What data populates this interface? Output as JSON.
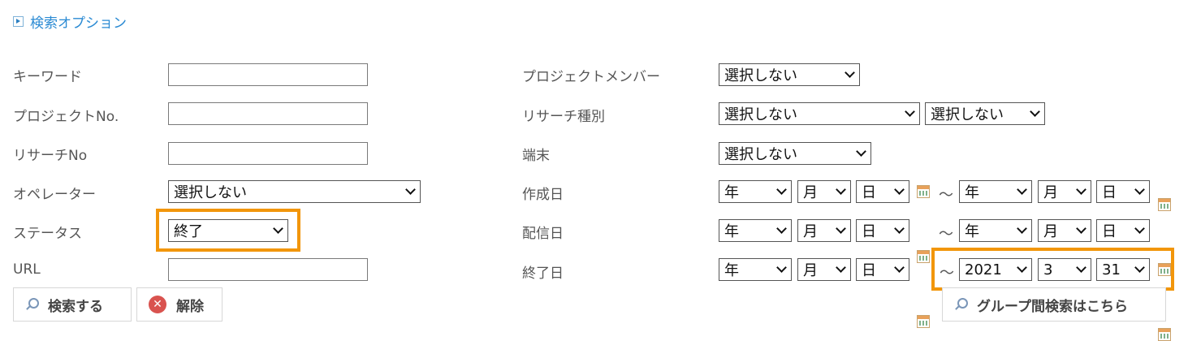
{
  "search_options": {
    "label": "検索オプション"
  },
  "left": {
    "keyword_label": "キーワード",
    "keyword_value": "",
    "project_no_label": "プロジェクトNo.",
    "project_no_value": "",
    "research_no_label": "リサーチNo",
    "research_no_value": "",
    "operator_label": "オペレーター",
    "operator_value": "選択しない",
    "status_label": "ステータス",
    "status_value": "終了",
    "url_label": "URL",
    "url_value": ""
  },
  "right": {
    "member_label": "プロジェクトメンバー",
    "member_value": "選択しない",
    "research_type_label": "リサーチ種別",
    "research_type_value1": "選択しない",
    "research_type_value2": "選択しない",
    "device_label": "端末",
    "device_value": "選択しない",
    "created_label": "作成日",
    "delivery_label": "配信日",
    "end_label": "終了日",
    "tilde": "～",
    "year_placeholder": "年",
    "month_placeholder": "月",
    "day_placeholder": "日",
    "end_to_year": "2021",
    "end_to_month": "3",
    "end_to_day": "31"
  },
  "buttons": {
    "search": "検索する",
    "clear": "解除",
    "group_search": "グループ間検索はこちら",
    "clear_icon_glyph": "✕"
  },
  "colors": {
    "highlight": "#f2960b",
    "link": "#2a8ad3"
  }
}
